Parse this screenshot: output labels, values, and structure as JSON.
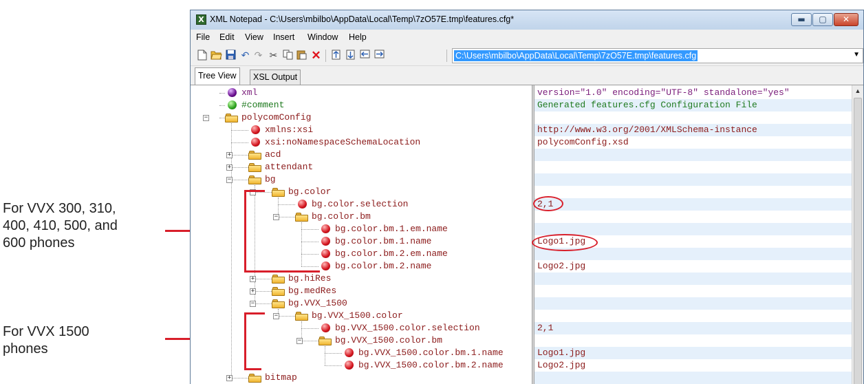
{
  "annotations": {
    "group1": [
      "For VVX 300, 310,",
      "400, 410, 500, and",
      " 600 phones"
    ],
    "group2": [
      "For VVX 1500",
      "phones"
    ]
  },
  "window": {
    "title": "XML Notepad - C:\\Users\\mbilbo\\AppData\\Local\\Temp\\7zO57E.tmp\\features.cfg*",
    "app_icon": "X",
    "buttons": {
      "minimize": "▬",
      "maximize": "▢",
      "close": "✕"
    }
  },
  "menu": [
    "File",
    "Edit",
    "View",
    "Insert",
    "Window",
    "Help"
  ],
  "toolbar": {
    "icons": [
      "new-icon",
      "open-icon",
      "save-icon",
      "undo-icon",
      "redo-icon",
      "cut-icon",
      "copy-icon",
      "paste-icon",
      "delete-icon",
      "nudge-up-icon",
      "nudge-down-icon",
      "nudge-left-icon",
      "nudge-right-icon"
    ],
    "path": "C:\\Users\\mbilbo\\AppData\\Local\\Temp\\7zO57E.tmp\\features.cfg"
  },
  "tabs": [
    "Tree View",
    "XSL Output"
  ],
  "tree": [
    {
      "label": "xml",
      "type": "pi",
      "value": "version=\"1.0\" encoding=\"UTF-8\" standalone=\"yes\""
    },
    {
      "label": "#comment",
      "type": "comment",
      "value": "Generated features.cfg Configuration File"
    },
    {
      "label": "polycomConfig",
      "type": "folder",
      "expander": "−",
      "value": ""
    },
    {
      "label": "xmlns:xsi",
      "type": "attr",
      "value": "http://www.w3.org/2001/XMLSchema-instance"
    },
    {
      "label": "xsi:noNamespaceSchemaLocation",
      "type": "attr",
      "value": "polycomConfig.xsd"
    },
    {
      "label": "acd",
      "type": "folder",
      "expander": "+",
      "value": ""
    },
    {
      "label": "attendant",
      "type": "folder",
      "expander": "+",
      "value": ""
    },
    {
      "label": "bg",
      "type": "folder",
      "expander": "−",
      "value": ""
    },
    {
      "label": "bg.color",
      "type": "folder",
      "expander": "−",
      "value": ""
    },
    {
      "label": "bg.color.selection",
      "type": "attr",
      "value": "2,1"
    },
    {
      "label": "bg.color.bm",
      "type": "folder",
      "expander": "−",
      "value": ""
    },
    {
      "label": "bg.color.bm.1.em.name",
      "type": "attr",
      "value": ""
    },
    {
      "label": "bg.color.bm.1.name",
      "type": "attr",
      "value": "Logo1.jpg"
    },
    {
      "label": "bg.color.bm.2.em.name",
      "type": "attr",
      "value": ""
    },
    {
      "label": "bg.color.bm.2.name",
      "type": "attr",
      "value": "Logo2.jpg"
    },
    {
      "label": "bg.hiRes",
      "type": "folder",
      "expander": "+",
      "value": ""
    },
    {
      "label": "bg.medRes",
      "type": "folder",
      "expander": "+",
      "value": ""
    },
    {
      "label": "bg.VVX_1500",
      "type": "folder",
      "expander": "−",
      "value": ""
    },
    {
      "label": "bg.VVX_1500.color",
      "type": "folder",
      "expander": "−",
      "value": ""
    },
    {
      "label": "bg.VVX_1500.color.selection",
      "type": "attr",
      "value": "2,1"
    },
    {
      "label": "bg.VVX_1500.color.bm",
      "type": "folder",
      "expander": "−",
      "value": ""
    },
    {
      "label": "bg.VVX_1500.color.bm.1.name",
      "type": "attr",
      "value": "Logo1.jpg"
    },
    {
      "label": "bg.VVX_1500.color.bm.2.name",
      "type": "attr",
      "value": "Logo2.jpg"
    },
    {
      "label": "bitmap",
      "type": "folder",
      "expander": "+",
      "value": ""
    }
  ],
  "colors": {
    "annotation_red": "#d81e2a",
    "selection_blue": "#3399ff",
    "alt_row": "#e5f0fb"
  }
}
